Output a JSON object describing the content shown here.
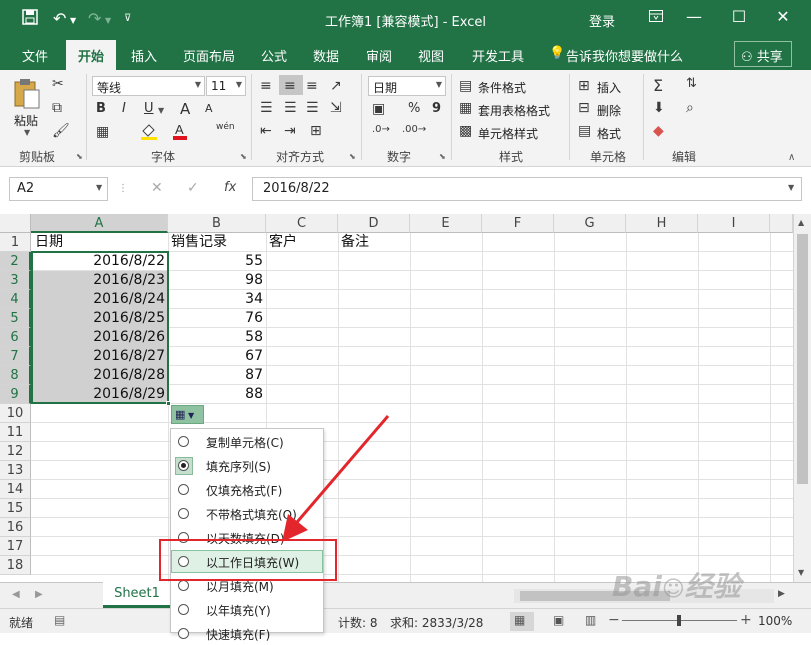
{
  "window": {
    "title": "工作簿1  [兼容模式] - Excel",
    "login": "登录",
    "qat": {
      "save_icon": "save-icon",
      "undo_icon": "undo-icon",
      "redo_icon": "redo-icon",
      "customize_icon": "chevron-down-icon"
    }
  },
  "tabs": {
    "file": "文件",
    "home": "开始",
    "insert": "插入",
    "page_layout": "页面布局",
    "formulas": "公式",
    "data": "数据",
    "review": "审阅",
    "view": "视图",
    "developer": "开发工具",
    "tell_me": "告诉我你想要做什么",
    "share": "共享"
  },
  "ribbon": {
    "clipboard": {
      "label": "剪贴板",
      "paste": "粘贴"
    },
    "font": {
      "label": "字体",
      "font_name": "等线",
      "font_size": "11",
      "bold": "B",
      "italic": "I",
      "underline": "U",
      "inc_font": "A",
      "dec_font": "A",
      "wen": "wén"
    },
    "alignment": {
      "label": "对齐方式"
    },
    "number": {
      "label": "数字",
      "format": "日期",
      "percent": "%",
      "comma": "9"
    },
    "styles": {
      "label": "样式",
      "conditional": "条件格式",
      "table": "套用表格格式",
      "cell_styles": "单元格样式"
    },
    "cells": {
      "label": "单元格",
      "insert": "插入",
      "delete": "删除",
      "format": "格式"
    },
    "editing": {
      "label": "编辑"
    }
  },
  "formula_bar": {
    "name_box": "A2",
    "formula": "2016/8/22"
  },
  "columns": [
    "A",
    "B",
    "C",
    "D",
    "E",
    "F",
    "G",
    "H",
    "I"
  ],
  "rows": [
    "1",
    "2",
    "3",
    "4",
    "5",
    "6",
    "7",
    "8",
    "9",
    "10",
    "11",
    "12",
    "13",
    "14",
    "15",
    "16",
    "17",
    "18"
  ],
  "header_row": {
    "a": "日期",
    "b": "销售记录",
    "c": "客户",
    "d": "备注"
  },
  "data_rows": [
    {
      "date": "2016/8/22",
      "sales": "55"
    },
    {
      "date": "2016/8/23",
      "sales": "98"
    },
    {
      "date": "2016/8/24",
      "sales": "34"
    },
    {
      "date": "2016/8/25",
      "sales": "76"
    },
    {
      "date": "2016/8/26",
      "sales": "58"
    },
    {
      "date": "2016/8/27",
      "sales": "67"
    },
    {
      "date": "2016/8/28",
      "sales": "87"
    },
    {
      "date": "2016/8/29",
      "sales": "88"
    }
  ],
  "autofill_menu": [
    {
      "label": "复制单元格(C)",
      "selected": false
    },
    {
      "label": "填充序列(S)",
      "selected": true
    },
    {
      "label": "仅填充格式(F)",
      "selected": false
    },
    {
      "label": "不带格式填充(O)",
      "selected": false
    },
    {
      "label": "以天数填充(D)",
      "selected": false
    },
    {
      "label": "以工作日填充(W)",
      "selected": false
    },
    {
      "label": "以月填充(M)",
      "selected": false
    },
    {
      "label": "以年填充(Y)",
      "selected": false
    },
    {
      "label": "快速填充(F)",
      "selected": false
    }
  ],
  "sheet_tab": "Sheet1",
  "status": {
    "ready": "就绪",
    "count": "计数: 8",
    "sum": "求和: 2833/3/28",
    "zoom": "100%"
  },
  "colors": {
    "excel_green": "#217346",
    "callout_red": "#e2262b"
  }
}
